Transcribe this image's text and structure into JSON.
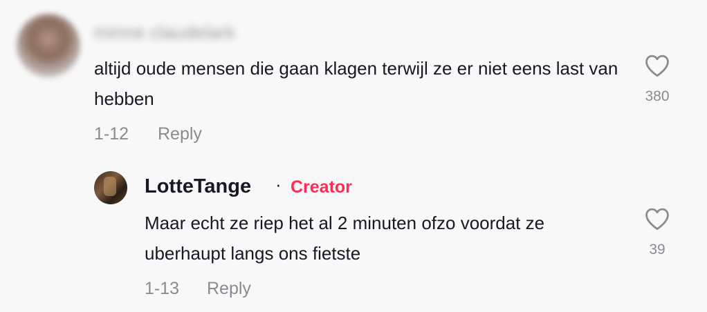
{
  "comments": [
    {
      "username": "minne claudelark",
      "text": "altijd oude mensen die gaan klagen terwijl ze er niet eens last van hebben",
      "date": "1-12",
      "reply_label": "Reply",
      "likes": "380",
      "like_icon": "heart-outline-icon"
    }
  ],
  "reply": {
    "username": "LotteTange",
    "separator": "·",
    "badge": "Creator",
    "text": "Maar echt ze riep het al 2 minuten ofzo voordat ze uberhaupt langs ons fietste",
    "date": "1-13",
    "reply_label": "Reply",
    "likes": "39",
    "like_icon": "heart-outline-icon"
  },
  "colors": {
    "accent_creator": "#fe2c55",
    "text_primary": "#161823",
    "text_secondary": "#8a8b91",
    "background": "#f8f8f8"
  }
}
